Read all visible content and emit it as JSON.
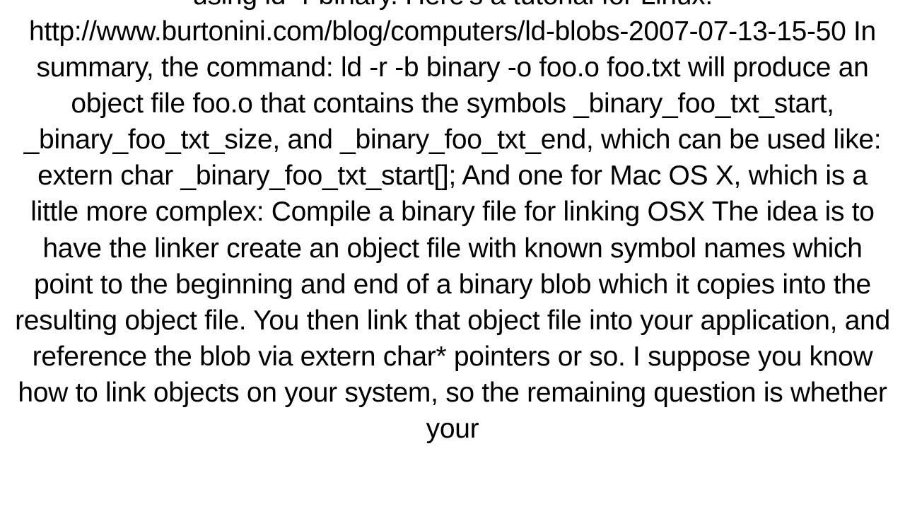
{
  "body_text": "using ld -r binary.  Here's a tutorial for Linux: http://www.burtonini.com/blog/computers/ld-blobs-2007-07-13-15-50 In summary, the command: ld -r -b binary -o foo.o foo.txt  will produce an object file foo.o that contains the symbols _binary_foo_txt_start, _binary_foo_txt_size, and _binary_foo_txt_end, which can be used like: extern char _binary_foo_txt_start[];  And one for Mac OS X, which is a little more complex: Compile a binary file for linking OSX The idea is to have the linker create an object file with known symbol names which point to the beginning and end of a binary blob which it copies into the resulting object file.  You then link that object file into your application, and reference the blob via extern char* pointers or so. I suppose you know how to link objects on your system, so the remaining question is whether your"
}
